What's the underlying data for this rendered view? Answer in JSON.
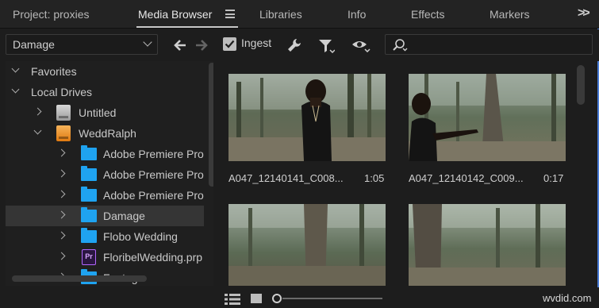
{
  "tabs": [
    {
      "label": "Project: proxies"
    },
    {
      "label": "Media Browser"
    },
    {
      "label": "Libraries"
    },
    {
      "label": "Info"
    },
    {
      "label": "Effects"
    },
    {
      "label": "Markers"
    }
  ],
  "toolbar": {
    "location": "Damage",
    "ingest_label": "Ingest",
    "ingest_checked": true
  },
  "tree": {
    "items": [
      {
        "label": "Favorites",
        "icon": "none",
        "expand": "down"
      },
      {
        "label": "Local Drives",
        "icon": "none",
        "expand": "down"
      },
      {
        "label": "Untitled",
        "icon": "drive-grey-icon",
        "expand": "right"
      },
      {
        "label": "WeddRalph",
        "icon": "drive-orange-icon",
        "expand": "down"
      },
      {
        "label": "Adobe Premiere Pro",
        "icon": "folder-icon",
        "expand": "right"
      },
      {
        "label": "Adobe Premiere Pro",
        "icon": "folder-icon",
        "expand": "right"
      },
      {
        "label": "Adobe Premiere Pro",
        "icon": "folder-icon",
        "expand": "right"
      },
      {
        "label": "Damage",
        "icon": "folder-icon",
        "expand": "right",
        "selected": true
      },
      {
        "label": "Flobo Wedding",
        "icon": "folder-icon",
        "expand": "right"
      },
      {
        "label": "FloribelWedding.prp",
        "icon": "prproj-file-icon",
        "expand": "right"
      },
      {
        "label": "Footage",
        "icon": "folder-icon",
        "expand": "right"
      }
    ]
  },
  "clips": [
    {
      "name": "A047_12140141_C008...",
      "duration": "1:05"
    },
    {
      "name": "A047_12140142_C009...",
      "duration": "0:17"
    },
    {
      "name": "",
      "duration": ""
    },
    {
      "name": "",
      "duration": ""
    }
  ],
  "footer": {
    "watermark": "wvdid.com"
  },
  "colors": {
    "accent_border": "#4a7cd6",
    "folder": "#1fa3f0",
    "prproj": "#b266ff"
  }
}
